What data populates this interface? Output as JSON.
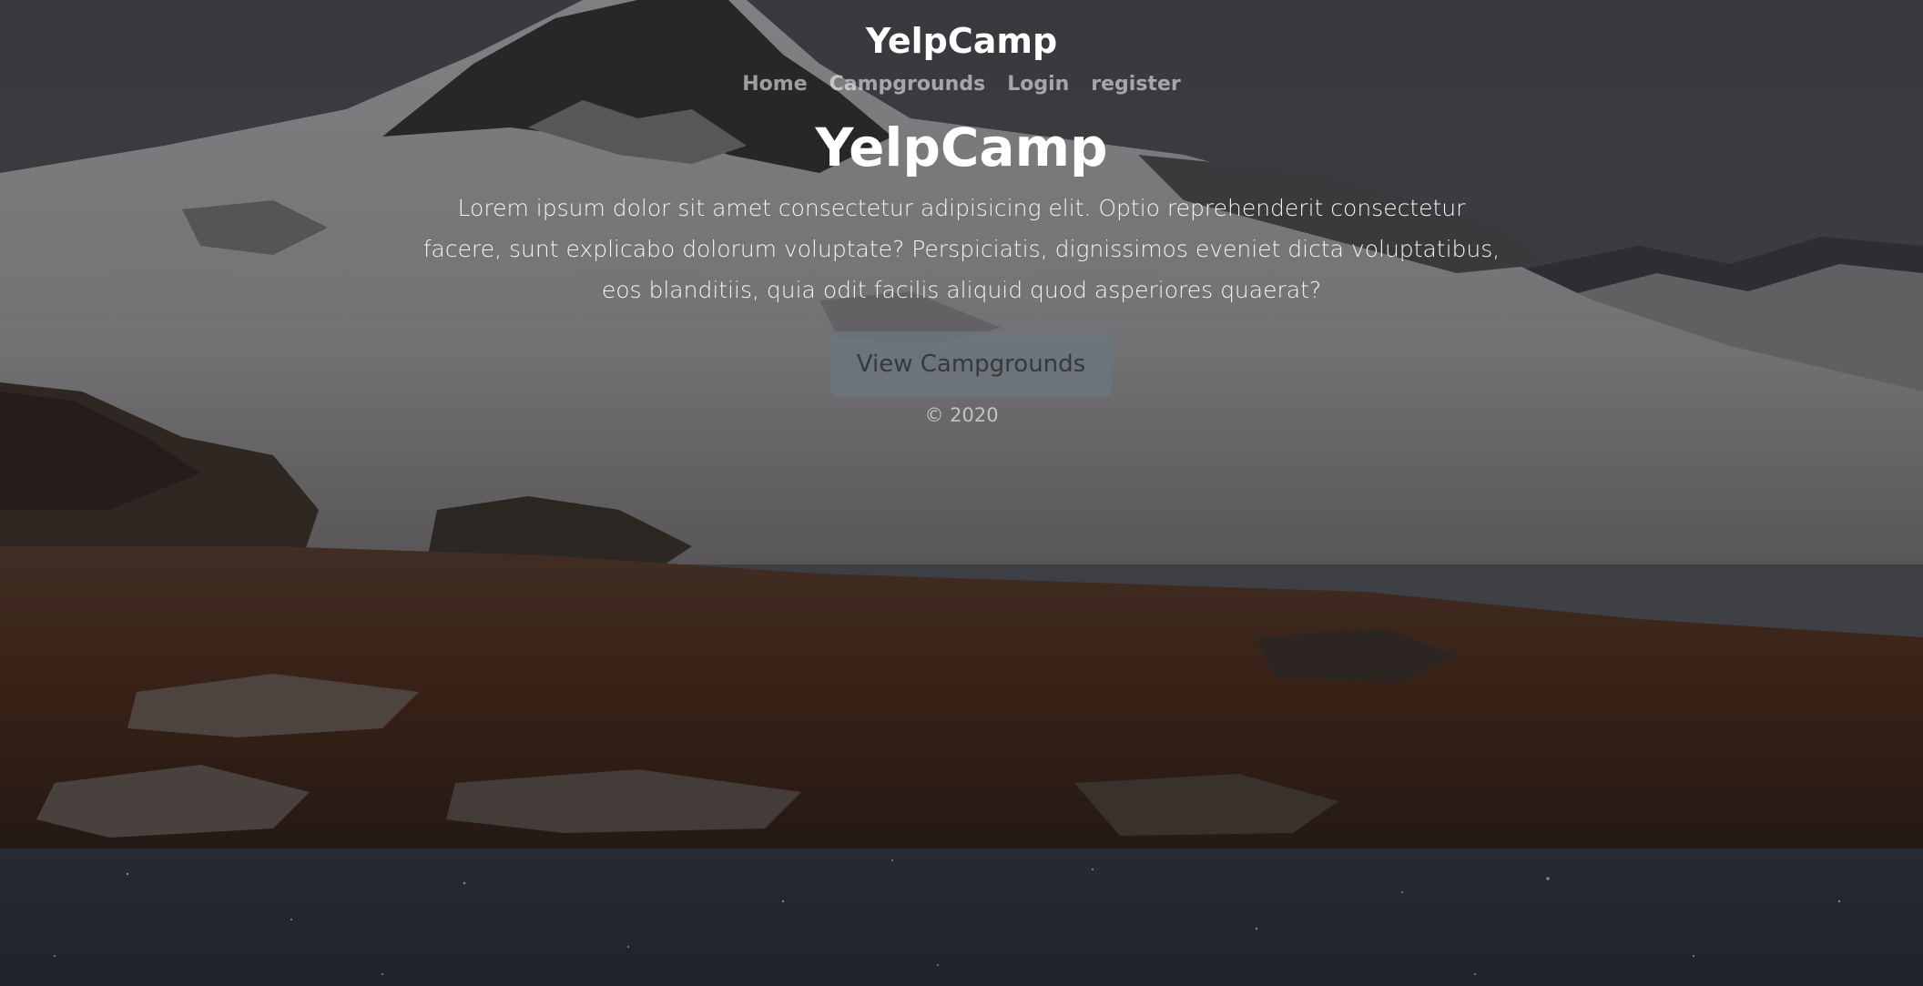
{
  "header": {
    "brand": "YelpCamp",
    "nav": [
      {
        "label": "Home"
      },
      {
        "label": "Campgrounds"
      },
      {
        "label": "Login"
      },
      {
        "label": "register"
      }
    ]
  },
  "hero": {
    "title": "YelpCamp",
    "lead": "Lorem ipsum dolor sit amet consectetur adipisicing elit. Optio reprehenderit consectetur facere, sunt explicabo dolorum voluptate? Perspiciatis, dignissimos eveniet dicta voluptatibus, eos blanditiis, quia odit facilis aliquid quod asperiores quaerat?",
    "button_label": "View Campgrounds"
  },
  "footer": {
    "copyright": "© 2020"
  },
  "colors": {
    "overlay": "#000000",
    "button_bg": "#6c757d",
    "nav_text": "rgba(255,255,255,0.55)",
    "lower_band": "#22262d"
  }
}
